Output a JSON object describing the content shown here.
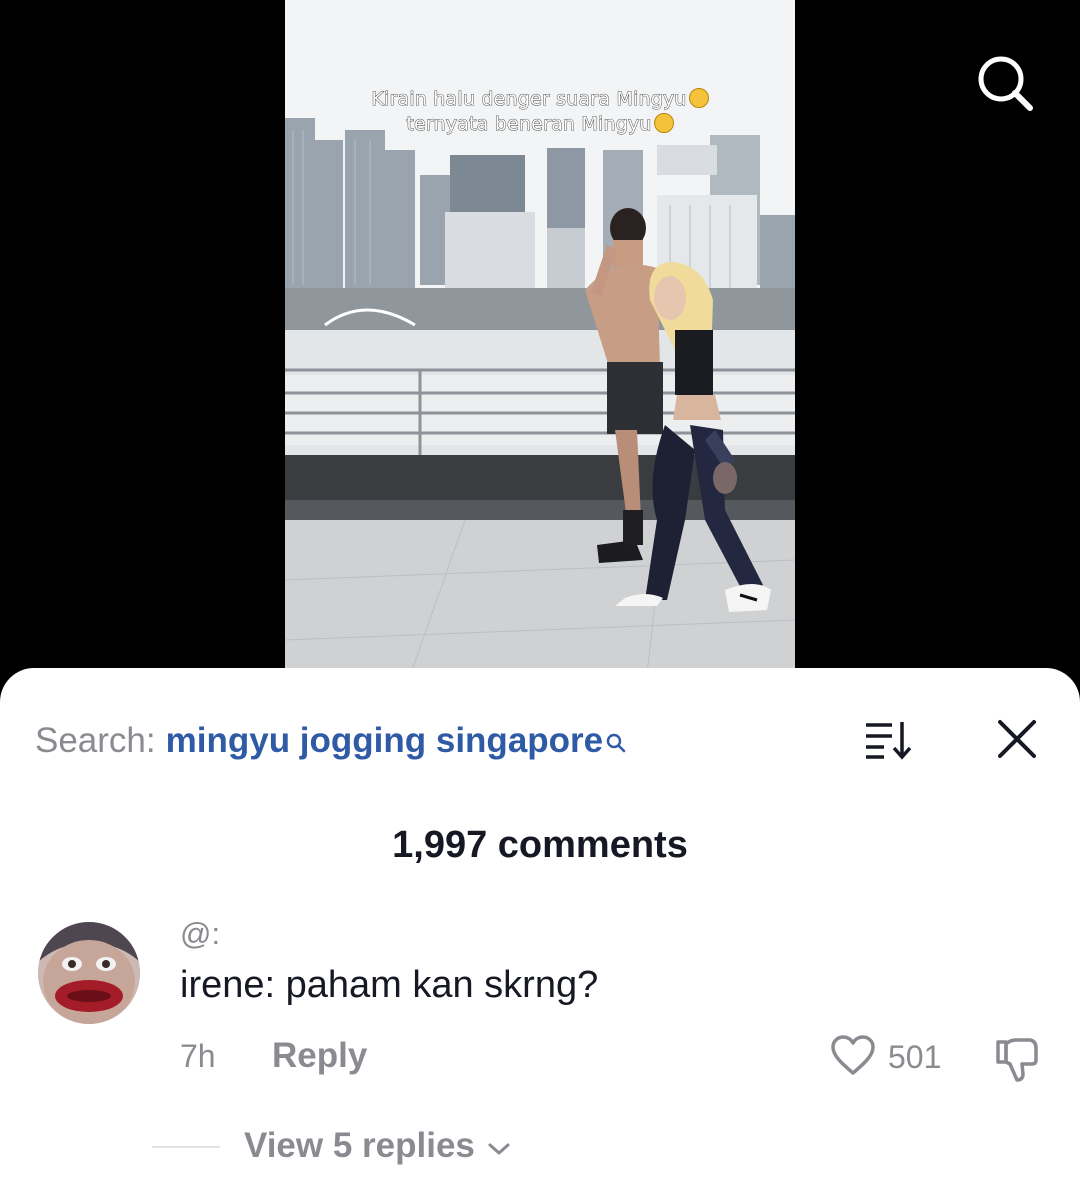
{
  "video": {
    "caption_line1": "Kirain halu denger suara Mingyu",
    "caption_line2": "ternyata beneran Mingyu",
    "caption_emoji1": "weary-face-emoji",
    "caption_emoji2": "yum-face-emoji"
  },
  "top_bar": {
    "search_icon": "search-icon"
  },
  "sheet": {
    "search_label": "Search:",
    "search_query": "mingyu jogging singapore",
    "sort_icon": "sort-icon",
    "close_icon": "close-icon",
    "comment_count": "1,997 comments"
  },
  "comments": [
    {
      "username": "@:",
      "text": "irene: paham kan skrng?",
      "time": "7h",
      "reply_label": "Reply",
      "likes": "501",
      "view_replies": "View 5 replies"
    }
  ],
  "colors": {
    "query_link": "#2f5aa5",
    "muted_text": "#8a8b91",
    "primary_text": "#161823",
    "background": "#000000",
    "sheet": "#ffffff"
  }
}
